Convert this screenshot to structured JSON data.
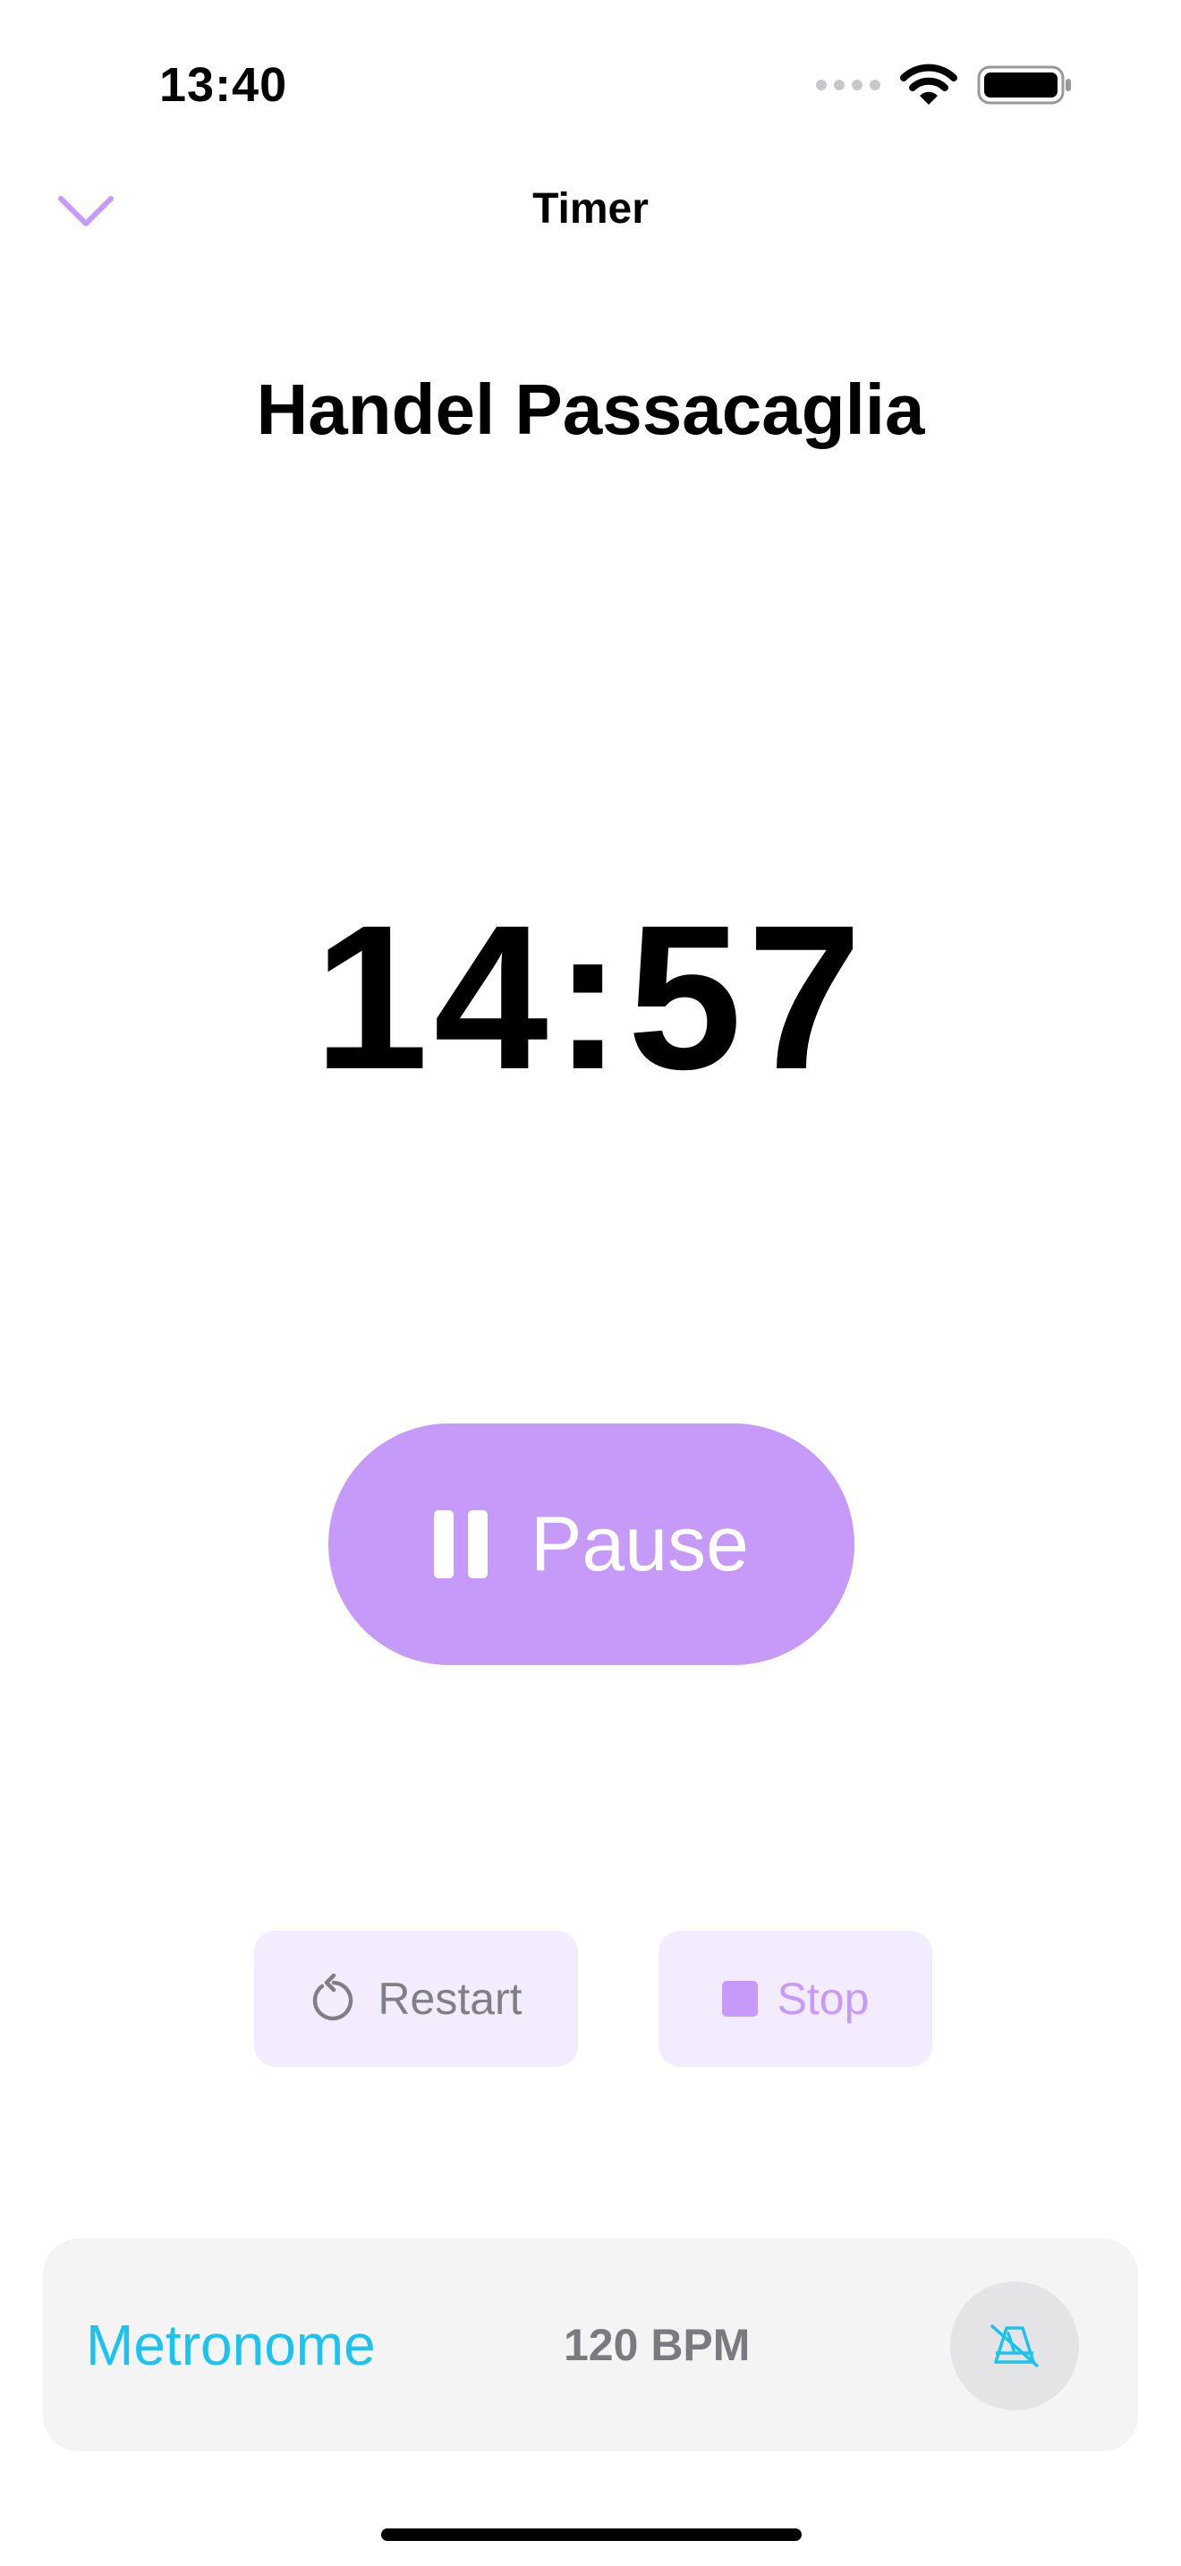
{
  "status_bar": {
    "time": "13:40"
  },
  "nav": {
    "title": "Timer",
    "back_icon": "chevron-down-icon"
  },
  "piece": {
    "title": "Handel Passacaglia"
  },
  "timer": {
    "display": "14:57"
  },
  "controls": {
    "pause_label": "Pause",
    "restart_label": "Restart",
    "stop_label": "Stop"
  },
  "metronome": {
    "label": "Metronome",
    "bpm": "120 BPM",
    "toggle_icon": "metronome-off-icon"
  },
  "colors": {
    "accent": "#c59af8",
    "accent_light": "#f3ebfe",
    "metronome": "#1bc4ee",
    "card_background": "#f4f4f4"
  }
}
